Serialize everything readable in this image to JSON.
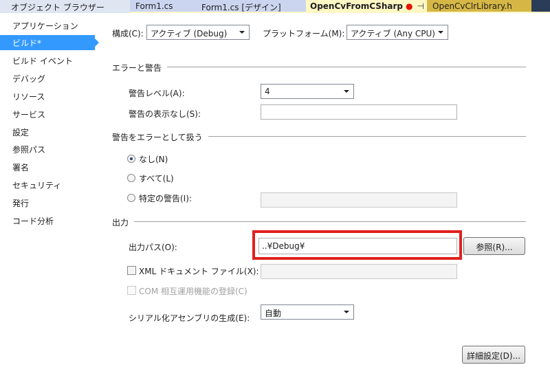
{
  "tabs": {
    "explorer": "オブジェクト ブラウザー",
    "form1_cs": "Form1.cs",
    "form1_design": "Form1.cs [デザイン]",
    "active": "OpenCvFromCSharp",
    "active_modified_marker": "●",
    "active_pin": "⊣",
    "active_close": "✕",
    "clr_library": "OpenCvClrLibrary.h"
  },
  "sidebar": {
    "items": [
      {
        "label": "アプリケーション"
      },
      {
        "label": "ビルド*",
        "selected": true
      },
      {
        "label": "ビルド イベント"
      },
      {
        "label": "デバッグ"
      },
      {
        "label": "リソース"
      },
      {
        "label": "サービス"
      },
      {
        "label": "設定"
      },
      {
        "label": "参照パス"
      },
      {
        "label": "署名"
      },
      {
        "label": "セキュリティ"
      },
      {
        "label": "発行"
      },
      {
        "label": "コード分析"
      }
    ]
  },
  "config_bar": {
    "config_label": "構成(C):",
    "config_value": "アクティブ (Debug)",
    "platform_label": "プラットフォーム(M):",
    "platform_value": "アクティブ (Any CPU)"
  },
  "errors_warnings": {
    "title": "エラーと警告",
    "warning_level_label": "警告レベル(A):",
    "warning_level_value": "4",
    "suppress_label": "警告の表示なし(S):",
    "suppress_value": ""
  },
  "treat_warnings": {
    "title": "警告をエラーとして扱う",
    "options": [
      {
        "label": "なし(N)",
        "checked": true
      },
      {
        "label": "すべて(L)",
        "checked": false
      },
      {
        "label": "特定の警告(I):",
        "checked": false
      }
    ],
    "specific_value": ""
  },
  "output": {
    "title": "出力",
    "path_label": "出力パス(O):",
    "path_value": "..¥Debug¥",
    "browse_button": "参照(R)...",
    "xml_doc_label": "XML ドキュメント ファイル(X):",
    "xml_doc_value": "",
    "com_interop_label": "COM 相互運用機能の登録(C)",
    "serialization_label": "シリアル化アセンブリの生成(E):",
    "serialization_value": "自動"
  },
  "advanced_button": "詳細設定(D)...",
  "colors": {
    "accent_selected": "#3399ff",
    "highlight_box": "#e0201e",
    "tab_strip": "#2b3c59",
    "active_tab": "#fff8c5"
  }
}
